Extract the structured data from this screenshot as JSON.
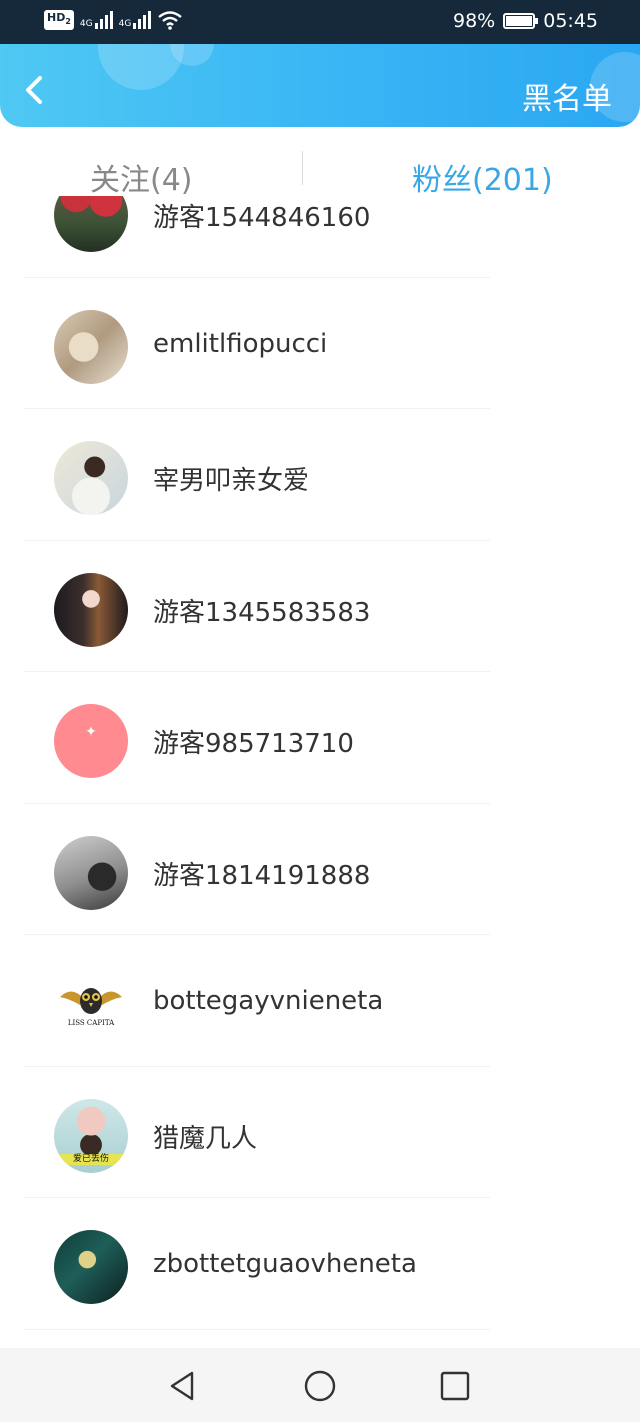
{
  "status_bar": {
    "hd": "HD",
    "hd_sub": "2",
    "net1": "4G",
    "net2": "4G",
    "battery": "98%",
    "time": "05:45",
    "icons": [
      "signal-icon",
      "wifi-icon",
      "battery-icon"
    ]
  },
  "header": {
    "back_icon": "chevron-left-icon",
    "blacklist_label": "黑名单"
  },
  "tabs": {
    "follow_label": "关注(4)",
    "fans_label": "粉丝(201)",
    "active": "fans"
  },
  "fans": [
    {
      "name": "游客1544846160"
    },
    {
      "name": "emlitlfiopucci"
    },
    {
      "name": "宰男叩亲女爱"
    },
    {
      "name": "游客1345583583"
    },
    {
      "name": "游客985713710"
    },
    {
      "name": "游客1814191888"
    },
    {
      "name": "bottegayvnieneta",
      "avatar_text": "LISS CAPITA"
    },
    {
      "name": "猎魔几人",
      "avatar_text": "爱已丢伤"
    },
    {
      "name": "zbottetguaovheneta"
    }
  ],
  "nav": {
    "icons": [
      "back-triangle-icon",
      "home-circle-icon",
      "recents-square-icon"
    ]
  },
  "colors": {
    "status_bg": "#15293a",
    "header_gradient_start": "#4fc8f3",
    "header_gradient_end": "#2aa7f2",
    "active_tab": "#39a7e6",
    "inactive_tab": "#888888"
  }
}
